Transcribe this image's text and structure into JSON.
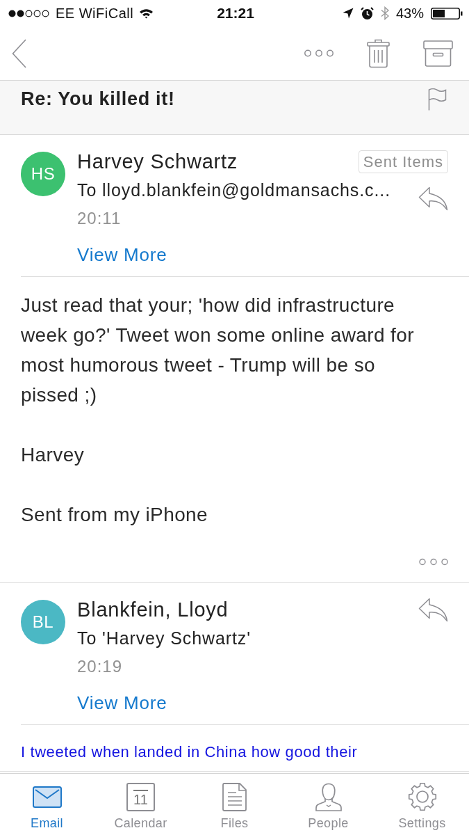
{
  "status_bar": {
    "carrier": "EE WiFiCall",
    "time": "21:21",
    "battery": "43%"
  },
  "subject": {
    "title": "Re: You killed it!",
    "flagged": false
  },
  "messages": [
    {
      "kind": "plain",
      "initials": "HS",
      "color": "#3cc170",
      "sender": "Harvey Schwartz",
      "folder_badge": "Sent Items",
      "to": "To lloyd.blankfein@goldmansachs.c...",
      "time": "20:11",
      "view_more": "View More",
      "body": [
        "Just read that your; 'how did infrastructure week go?' Tweet won some online award for most humorous tweet - Trump will be so pissed ;)",
        "Harvey",
        "Sent from my iPhone"
      ],
      "more_button": true
    },
    {
      "kind": "html",
      "initials": "BL",
      "color": "#4bb8c4",
      "sender": "Blankfein, Lloyd",
      "to": "To 'Harvey Schwartz'",
      "time": "20:19",
      "view_more": "View More",
      "body": [
        "I tweeted when landed in China how good their"
      ],
      "more_button": false
    }
  ],
  "tabs": [
    {
      "kind": "email",
      "label": "Email",
      "selected": true
    },
    {
      "kind": "calendar",
      "label": "Calendar",
      "date": "11",
      "selected": false
    },
    {
      "kind": "files",
      "label": "Files",
      "selected": false
    },
    {
      "kind": "people",
      "label": "People",
      "selected": false
    },
    {
      "kind": "settings",
      "label": "Settings",
      "selected": false
    }
  ]
}
